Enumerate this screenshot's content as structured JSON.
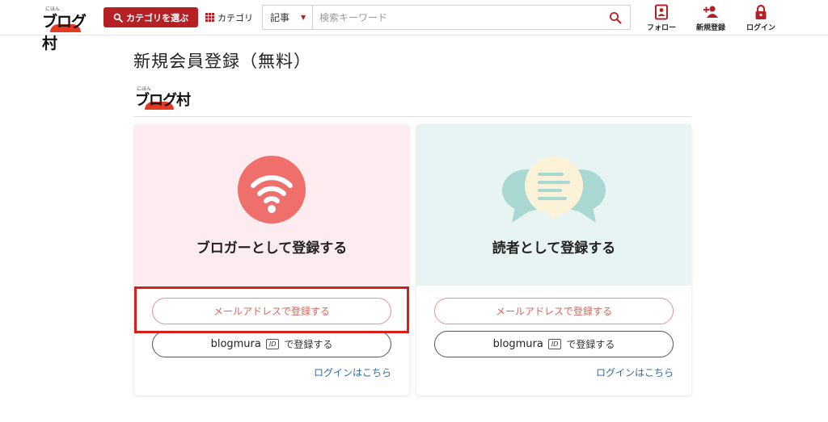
{
  "header": {
    "logo": {
      "small": "にほん",
      "main": "ブログ村"
    },
    "category_select_label": "カテゴリを選ぶ",
    "category_label": "カテゴリ",
    "search": {
      "type_value": "記事",
      "placeholder": "検索キーワード"
    },
    "icons": [
      {
        "name": "follow",
        "label": "フォロー"
      },
      {
        "name": "register",
        "label": "新規登録"
      },
      {
        "name": "login",
        "label": "ログイン"
      }
    ]
  },
  "main": {
    "title": "新規会員登録（無料）",
    "logo": {
      "small": "にほん",
      "main": "ブログ村"
    },
    "cards": [
      {
        "title": "ブロガーとして登録する",
        "icon": "wifi-icon",
        "mail_button": "メールアドレスで登録する",
        "blogmura_brand": "blogmura",
        "id_badge": "ID",
        "blogmura_suffix": "で登録する",
        "login_link": "ログインはこちら",
        "bg": "#fdecef"
      },
      {
        "title": "読者として登録する",
        "icon": "chat-bubbles-icon",
        "mail_button": "メールアドレスで登録する",
        "blogmura_brand": "blogmura",
        "id_badge": "ID",
        "blogmura_suffix": "で登録する",
        "login_link": "ログインはこちら",
        "bg": "#e8f4f3"
      }
    ]
  },
  "colors": {
    "brand_red": "#b52025",
    "logo_sun": "#e53a20",
    "wifi_circle": "#ee6f6c",
    "highlight": "#d81e1e",
    "link_blue": "#2b6cb0"
  }
}
